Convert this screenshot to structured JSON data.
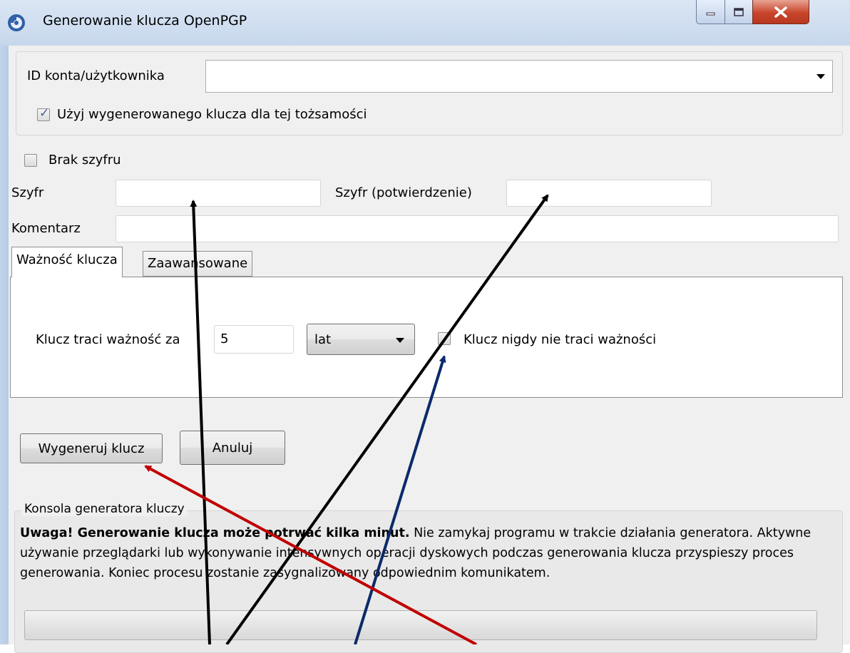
{
  "window": {
    "title": "Generowanie klucza OpenPGP"
  },
  "account": {
    "label": "ID konta/użytkownika",
    "value": "",
    "use_key_label": "Użyj wygenerowanego klucza dla tej tożsamości",
    "use_key_checked": true
  },
  "passphrase": {
    "no_cipher_label": "Brak szyfru",
    "no_cipher_checked": false,
    "cipher_label": "Szyfr",
    "cipher_value": "",
    "confirm_label": "Szyfr (potwierdzenie)",
    "confirm_value": "",
    "comment_label": "Komentarz",
    "comment_value": ""
  },
  "tabs": [
    {
      "label": "Ważność klucza",
      "active": true
    },
    {
      "label": "Zaawansowane",
      "active": false
    }
  ],
  "expiry": {
    "label": "Klucz traci ważność za",
    "value": "5",
    "unit": "lat",
    "never_label": "Klucz nigdy nie traci ważności",
    "never_checked": false
  },
  "buttons": {
    "generate": "Wygeneruj klucz",
    "cancel": "Anuluj"
  },
  "console": {
    "title": "Konsola generatora kluczy",
    "warning_bold": "Uwaga! Generowanie klucza może potrwać kilka minut.",
    "warning_text": " Nie zamykaj programu w trakcie działania generatora. Aktywne używanie przeglądarki lub wykonywanie intensywnych operacji dyskowych podczas generowania klucza przyspieszy proces generowania. Koniec procesu zostanie zasygnalizowany odpowiednim komunikatem."
  },
  "colors": {
    "arrow_black": "#000000",
    "arrow_navy": "#0b2a6b",
    "arrow_red": "#c00000"
  }
}
